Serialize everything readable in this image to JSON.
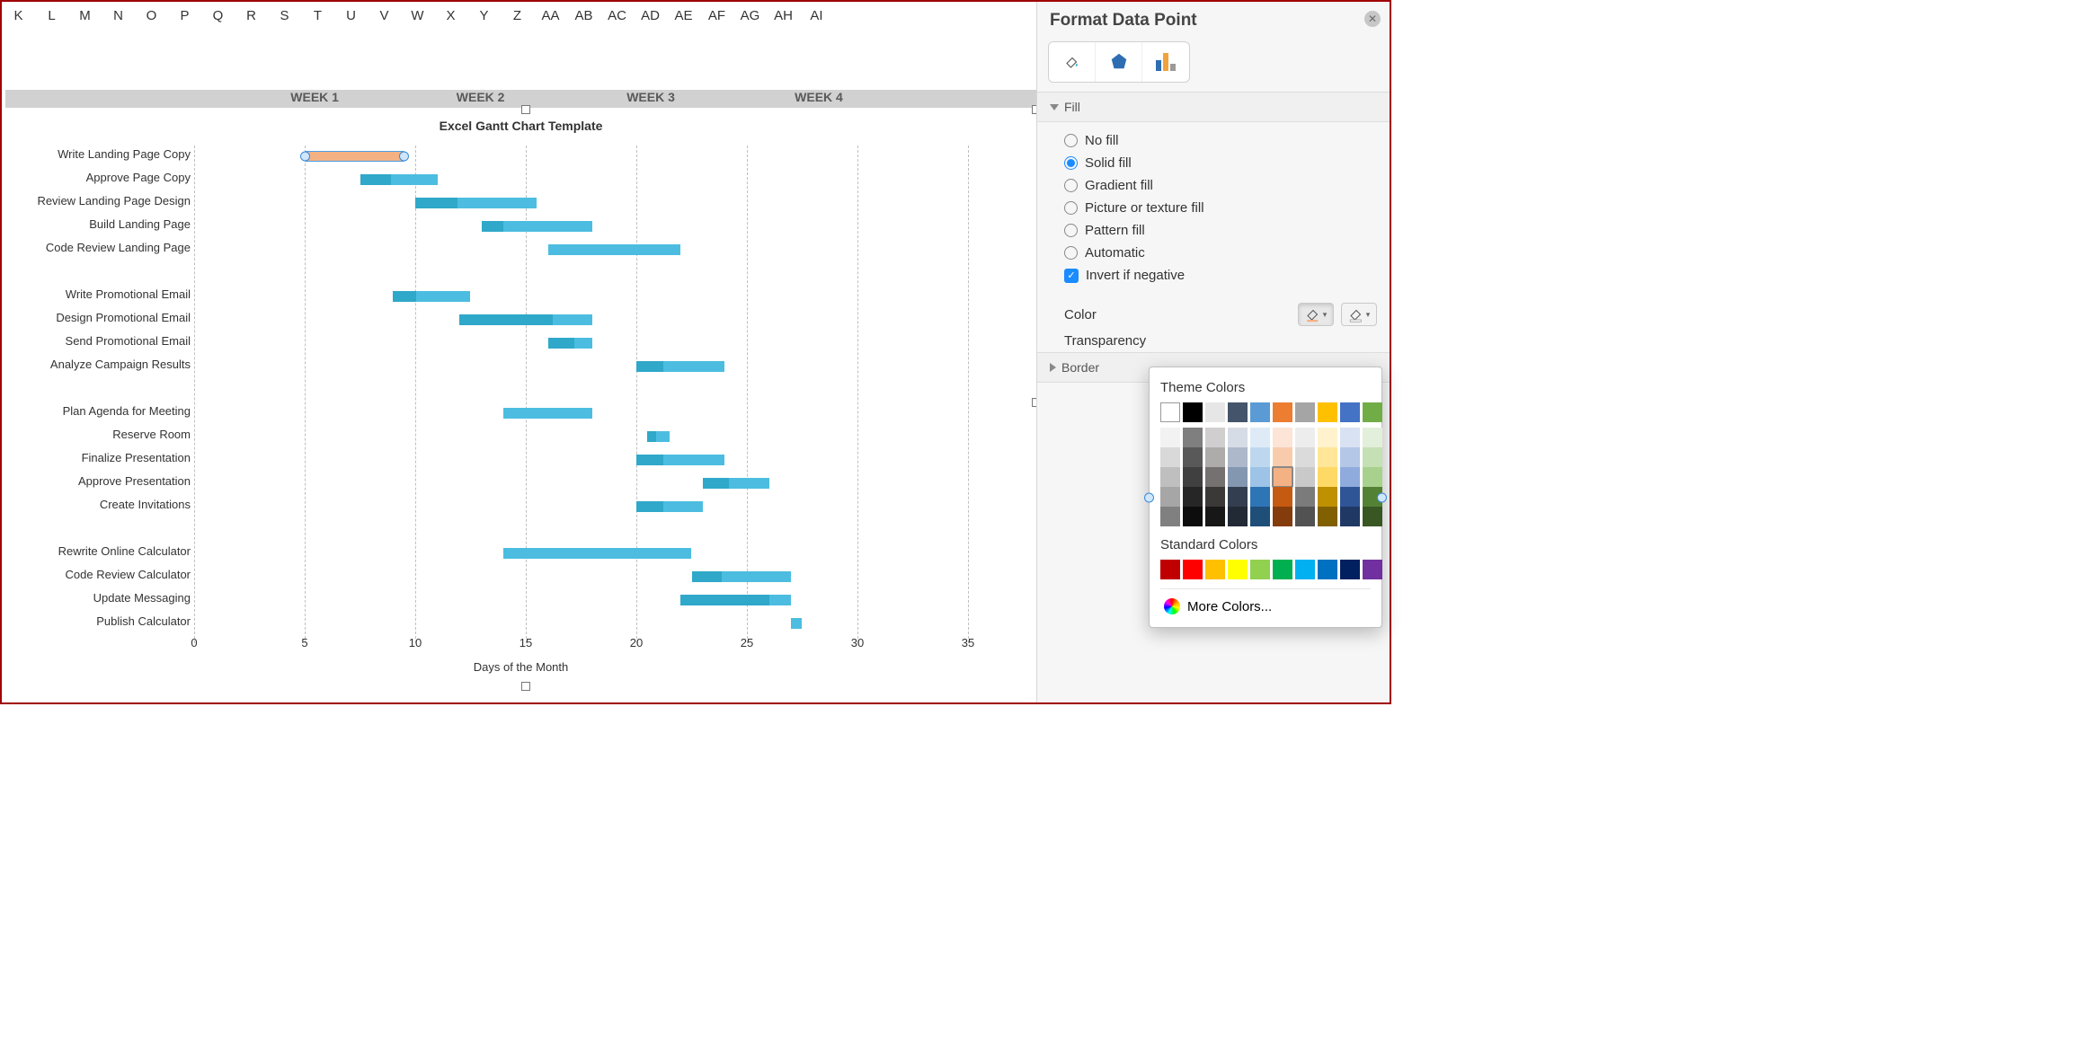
{
  "columns": [
    "K",
    "L",
    "M",
    "N",
    "O",
    "P",
    "Q",
    "R",
    "S",
    "T",
    "U",
    "V",
    "W",
    "X",
    "Y",
    "Z",
    "AA",
    "AB",
    "AC",
    "AD",
    "AE",
    "AF",
    "AG",
    "AH",
    "AI"
  ],
  "weeks": [
    "WEEK 1",
    "WEEK 2",
    "WEEK 3",
    "WEEK 4"
  ],
  "pane": {
    "title": "Format Data Point",
    "section_fill": "Fill",
    "section_border": "Border",
    "fill_options": [
      "No fill",
      "Solid fill",
      "Gradient fill",
      "Picture or texture fill",
      "Pattern fill",
      "Automatic"
    ],
    "invert": "Invert if negative",
    "color_label": "Color",
    "transparency_label": "Transparency",
    "popup": {
      "theme_title": "Theme Colors",
      "std_title": "Standard Colors",
      "more": "More Colors...",
      "theme_row0": [
        "#ffffff",
        "#000000",
        "#e7e6e6",
        "#44546a",
        "#5b9bd5",
        "#ed7d31",
        "#a5a5a5",
        "#ffc000",
        "#4472c4",
        "#70ad47"
      ],
      "theme_shades": [
        [
          "#f2f2f2",
          "#7f7f7f",
          "#d0cece",
          "#d6dce5",
          "#deebf7",
          "#fce4d6",
          "#ededed",
          "#fff2cc",
          "#d9e2f3",
          "#e2efda"
        ],
        [
          "#d9d9d9",
          "#595959",
          "#aeabab",
          "#adb9ca",
          "#bdd7ee",
          "#f8cbad",
          "#dbdbdb",
          "#ffe699",
          "#b4c7e7",
          "#c5e0b4"
        ],
        [
          "#bfbfbf",
          "#404040",
          "#757171",
          "#8497b0",
          "#9dc3e6",
          "#f4b183",
          "#c9c9c9",
          "#ffd966",
          "#8faadc",
          "#a9d18e"
        ],
        [
          "#a6a6a6",
          "#262626",
          "#3b3838",
          "#333f50",
          "#2e75b6",
          "#c55a11",
          "#7b7b7b",
          "#bf9000",
          "#2f5597",
          "#548235"
        ],
        [
          "#808080",
          "#0d0d0d",
          "#171717",
          "#222a35",
          "#1f4e79",
          "#843c0c",
          "#525252",
          "#806000",
          "#203864",
          "#385723"
        ]
      ],
      "standard": [
        "#c00000",
        "#ff0000",
        "#ffc000",
        "#ffff00",
        "#92d050",
        "#00b050",
        "#00b0f0",
        "#0070c0",
        "#002060",
        "#7030a0"
      ],
      "selected": "#f4b183"
    }
  },
  "chart_data": {
    "type": "bar",
    "title": "Excel Gantt Chart Template",
    "xlabel": "Days of the Month",
    "ylabel": "",
    "xlim": [
      0,
      35
    ],
    "xticks": [
      0,
      5,
      10,
      15,
      20,
      25,
      30,
      35
    ],
    "week_positions": [
      5.5,
      13.0,
      20.7,
      28.3
    ],
    "colors": {
      "primary": "#4cbde0",
      "secondary": "#2fa8c9",
      "selected": "#f4b183"
    },
    "tasks": [
      {
        "label": "Write Landing Page Copy",
        "start": 5,
        "dur": 4.5,
        "split": 0,
        "selected": true
      },
      {
        "label": "Approve Page Copy",
        "start": 7.5,
        "dur": 3.5,
        "split": 0.4
      },
      {
        "label": "Review Landing Page Design",
        "start": 10,
        "dur": 5.5,
        "split": 0.35
      },
      {
        "label": "Build Landing Page",
        "start": 13,
        "dur": 5,
        "split": 0.2
      },
      {
        "label": "Code Review Landing Page",
        "start": 16,
        "dur": 6,
        "split": 0
      },
      {
        "label": "",
        "start": 0,
        "dur": 0,
        "split": 0,
        "blank": true
      },
      {
        "label": "Write Promotional Email",
        "start": 9,
        "dur": 3.5,
        "split": 0.3
      },
      {
        "label": "Design Promotional Email",
        "start": 12,
        "dur": 6,
        "split": 0.7
      },
      {
        "label": "Send Promotional Email",
        "start": 16,
        "dur": 2,
        "split": 0.6
      },
      {
        "label": "Analyze Campaign Results",
        "start": 20,
        "dur": 4,
        "split": 0.3
      },
      {
        "label": "",
        "start": 0,
        "dur": 0,
        "split": 0,
        "blank": true
      },
      {
        "label": "Plan Agenda for Meeting",
        "start": 14,
        "dur": 4,
        "split": 0
      },
      {
        "label": "Reserve Room",
        "start": 20.5,
        "dur": 1,
        "split": 0.4
      },
      {
        "label": "Finalize Presentation",
        "start": 20,
        "dur": 4,
        "split": 0.3
      },
      {
        "label": "Approve Presentation",
        "start": 23,
        "dur": 3,
        "split": 0.4
      },
      {
        "label": "Create Invitations",
        "start": 20,
        "dur": 3,
        "split": 0.4
      },
      {
        "label": "",
        "start": 0,
        "dur": 0,
        "split": 0,
        "blank": true
      },
      {
        "label": "Rewrite Online Calculator",
        "start": 14,
        "dur": 8.5,
        "split": 0
      },
      {
        "label": "Code Review Calculator",
        "start": 22.5,
        "dur": 4.5,
        "split": 0.3
      },
      {
        "label": "Update Messaging",
        "start": 22,
        "dur": 5,
        "split": 0.8
      },
      {
        "label": "Publish Calculator",
        "start": 27,
        "dur": 0.5,
        "split": 0
      }
    ]
  }
}
